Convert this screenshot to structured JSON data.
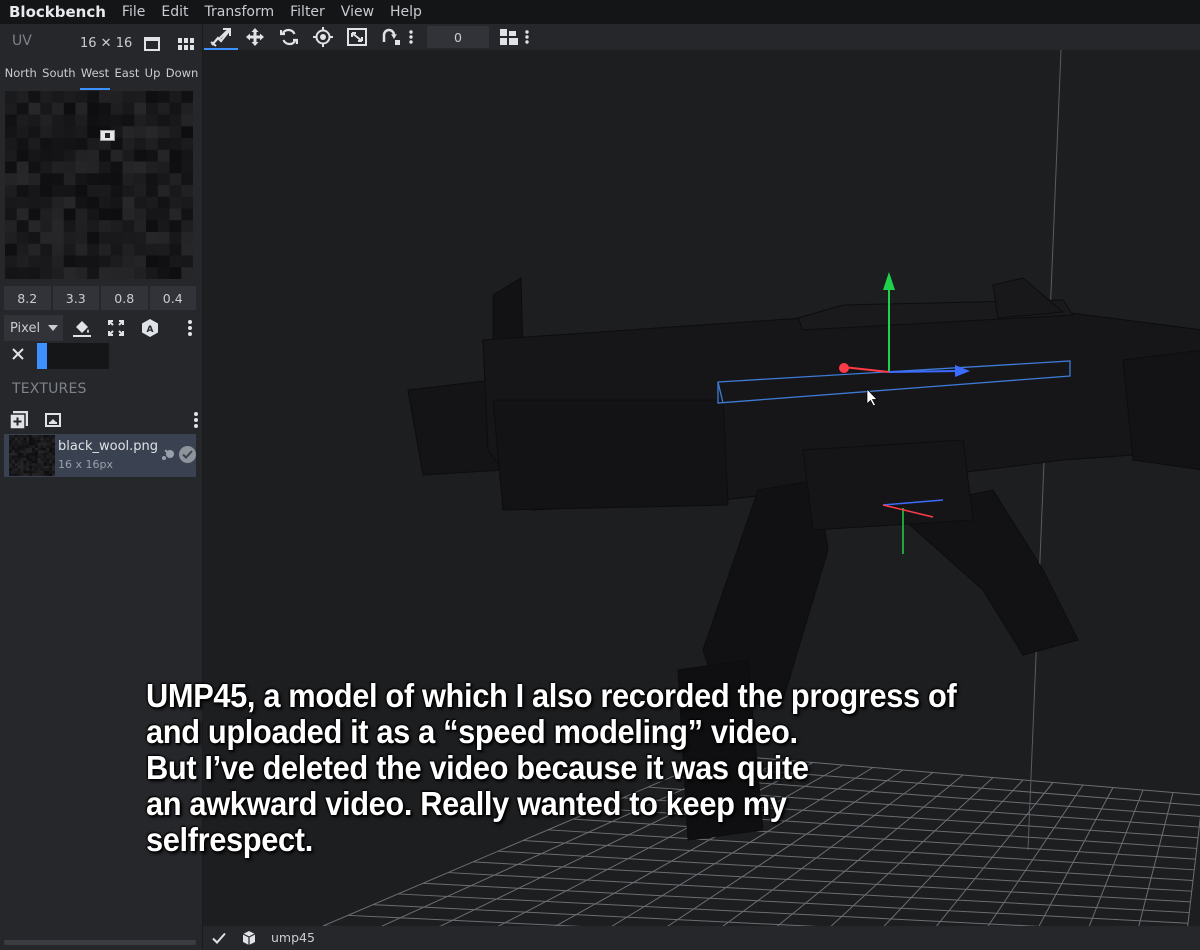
{
  "app": {
    "title": "Blockbench"
  },
  "menu": [
    "File",
    "Edit",
    "Transform",
    "Filter",
    "View",
    "Help"
  ],
  "uv_panel": {
    "title": "UV",
    "size_label": "16 ✕ 16",
    "face_tabs": [
      "North",
      "South",
      "West",
      "East",
      "Up",
      "Down"
    ],
    "active_face": "West",
    "values": [
      "8.2",
      "3.3",
      "0.8",
      "0.4"
    ]
  },
  "paint": {
    "mode": "Pixel"
  },
  "textures": {
    "title": "TEXTURES",
    "items": [
      {
        "name": "black_wool.png",
        "size": "16 x 16px"
      }
    ]
  },
  "toolbar": {
    "timeline_value": "0"
  },
  "icons": {
    "toolbar": [
      "move-tool-icon",
      "translate-icon",
      "rotate-icon",
      "pivot-icon",
      "resize-icon",
      "vertex-snap-icon",
      "more-icon",
      "layout-icon",
      "more-icon"
    ],
    "uv": [
      "uv-single-view-icon",
      "uv-grid-view-icon"
    ],
    "paint": [
      "fill-bucket-icon",
      "expand-icon",
      "auto-uv-icon",
      "more-icon"
    ],
    "textures": [
      "add-texture-icon",
      "import-texture-icon",
      "more-icon"
    ]
  },
  "colors": {
    "accent": "#3e90ff",
    "gizmo_x": "#ff3b47",
    "gizmo_y": "#20d14a",
    "gizmo_z": "#3b6cff",
    "selection": "#3e7bd6"
  },
  "status": {
    "model_name": "ump45"
  },
  "caption": {
    "text": "UMP45, a model of which I also recorded the progress of\nand uploaded it as a “speed modeling” video.\nBut I’ve deleted the video because it was quite\nan awkward video. Really wanted to keep my\nselfrespect."
  }
}
